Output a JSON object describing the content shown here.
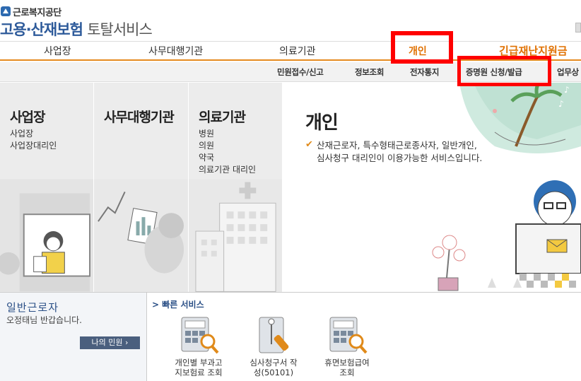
{
  "header": {
    "org_name": "근로복지공단",
    "service_main": "고용·산재보험",
    "service_sub": "토탈서비스"
  },
  "main_nav": {
    "items": [
      "사업장",
      "사무대행기관",
      "의료기관",
      "개인"
    ],
    "active": "개인",
    "urgent_label": "긴급재난지원금"
  },
  "sub_nav": {
    "items": [
      "민원접수/신고",
      "정보조회",
      "전자통지",
      "증명원 신청/발급",
      "업무상"
    ]
  },
  "panels": [
    {
      "title": "사업장",
      "links": [
        "사업장",
        "사업장대리인"
      ]
    },
    {
      "title": "사무대행기관",
      "links": []
    },
    {
      "title": "의료기관",
      "links": [
        "병원",
        "의원",
        "약국",
        "의료기관 대리인"
      ]
    }
  ],
  "personal": {
    "title": "개인",
    "desc_line1": "산재근로자, 특수형태근로종사자, 일반개인,",
    "desc_line2": "심사청구 대리인이 이용가능한 서비스입니다."
  },
  "user": {
    "type": "일반근로자",
    "greeting": "오정태님 반갑습니다.",
    "button": "나의 민원"
  },
  "quick": {
    "title": "> 빠른 서비스",
    "items": [
      {
        "label": "개인별 부과고\n지보험료 조회",
        "icon": "calculator-search-icon"
      },
      {
        "label": "심사청구서 작\n성(50101)",
        "icon": "document-pen-icon"
      },
      {
        "label": "휴면보험급여\n조회",
        "icon": "calculator-search-icon"
      }
    ]
  },
  "colors": {
    "accent": "#e07000",
    "brand_blue": "#2d5a9a",
    "highlight": "#ff0000"
  }
}
